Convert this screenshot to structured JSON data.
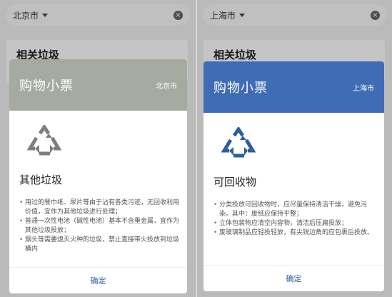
{
  "panels": [
    {
      "search": {
        "city": "北京市"
      },
      "related": {
        "title": "相关垃圾"
      },
      "modal": {
        "title": "购物小票",
        "city": "北京市",
        "header_color": "#a5aba1",
        "symbol_color": "#7c7f7b",
        "category": "其他垃圾",
        "tips": [
          "用过的餐巾纸、尿片等由于沾有各类污迹，无回收利用价值，宜作为其他垃圾进行处理；",
          "普通一次性电池（碱性电池）基本不含重金属，宜作为其他垃圾投放；",
          "烟头等需要熄灭火种的垃圾，禁止直接带火投放到垃圾桶内"
        ],
        "confirm": "确定"
      }
    },
    {
      "search": {
        "city": "上海市"
      },
      "related": {
        "title": "相关垃圾"
      },
      "modal": {
        "title": "购物小票",
        "city": "上海市",
        "header_color": "#3f6cb5",
        "symbol_color": "#2f5e9e",
        "category": "可回收物",
        "tips": [
          "分类投放可回收物时，应尽量保持清洁干燥，避免污染。其中：废纸应保持平整；",
          "立体包装物应清空内容物，清洁后压扁投放；",
          "废玻璃制品应轻投轻放，有尖锐边角的应包裹后投放。"
        ],
        "confirm": "确定"
      }
    }
  ],
  "icons": {
    "clear": "clear-circle-icon",
    "dropdown": "caret-down-icon",
    "recycle": "recycle-symbol-icon"
  }
}
